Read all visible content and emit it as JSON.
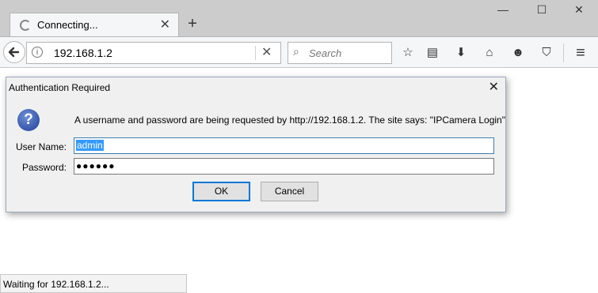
{
  "tab": {
    "title": "Connecting...",
    "close": "✕",
    "new_tab": "+"
  },
  "window": {
    "minimize": "—",
    "maximize": "☐",
    "close": "✕"
  },
  "navbar": {
    "url": "192.168.1.2",
    "info": "i",
    "stop": "✕",
    "search_placeholder": "Search"
  },
  "toolbar": {
    "bookmark": "☆",
    "reader": "▤",
    "download": "⬇",
    "home": "⌂",
    "smiley": "☻",
    "pocket": "⛉",
    "menu": "≡"
  },
  "dialog": {
    "title": "Authentication Required",
    "close": "✕",
    "icon": "?",
    "message": "A username and password are being requested by http://192.168.1.2. The site says: \"IPCamera Login\"",
    "username_label": "User Name:",
    "username_value": "admin",
    "password_label": "Password:",
    "password_value": "●●●●●●",
    "ok": "OK",
    "cancel": "Cancel"
  },
  "status": {
    "text": "Waiting for 192.168.1.2..."
  },
  "colors": {
    "accent": "#0078d7",
    "selection": "#3399ff",
    "chrome": "#cccccc"
  }
}
